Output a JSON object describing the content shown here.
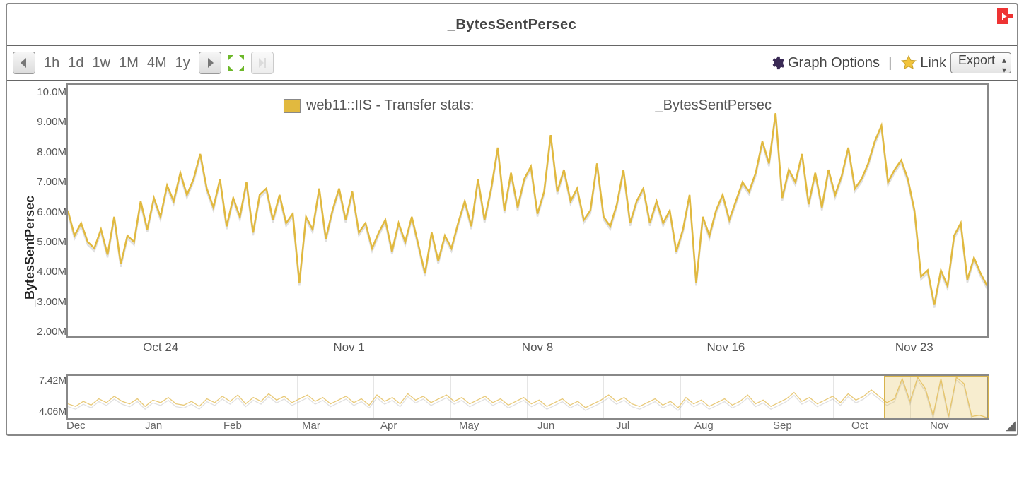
{
  "header": {
    "title": "_BytesSentPersec"
  },
  "toolbar": {
    "ranges": [
      "1h",
      "1d",
      "1w",
      "1M",
      "4M",
      "1y"
    ],
    "graph_options": "Graph Options",
    "link": "Link",
    "export": "Export",
    "separator": "|"
  },
  "legend": {
    "prefix": "web11::IIS - Transfer stats:",
    "suffix": "_BytesSentPersec",
    "color": "#e1b93f"
  },
  "y_axis": {
    "title": "_BytesSentPersec",
    "ticks": [
      "10.0M",
      "9.00M",
      "8.00M",
      "7.00M",
      "6.00M",
      "5.00M",
      "4.00M",
      "3.00M",
      "2.00M"
    ]
  },
  "x_axis": {
    "ticks": [
      "Oct 24",
      "Nov 1",
      "Nov 8",
      "Nov 16",
      "Nov 23"
    ]
  },
  "overview": {
    "y_ticks": [
      "7.42M",
      "4.06M"
    ],
    "x_ticks": [
      "Dec",
      "Jan",
      "Feb",
      "Mar",
      "Apr",
      "May",
      "Jun",
      "Jul",
      "Aug",
      "Sep",
      "Oct",
      "Nov"
    ],
    "selection": {
      "left_pct": 88.8,
      "width_pct": 11.2
    }
  },
  "chart_data": {
    "type": "line",
    "title": "_BytesSentPersec",
    "xlabel": "",
    "ylabel": "_BytesSentPersec",
    "ylim": [
      2000000,
      10000000
    ],
    "x_categories": [
      "Oct 24",
      "Nov 1",
      "Nov 8",
      "Nov 16",
      "Nov 23"
    ],
    "series": [
      {
        "name": "web11::IIS - Transfer stats: _BytesSentPersec",
        "color": "#e1b93f",
        "values": [
          6.0,
          5.2,
          5.6,
          5.0,
          4.8,
          5.4,
          4.6,
          5.8,
          4.3,
          5.2,
          5.0,
          6.3,
          5.4,
          6.4,
          5.8,
          6.8,
          6.3,
          7.2,
          6.5,
          7.0,
          7.8,
          6.7,
          6.1,
          7.0,
          5.5,
          6.4,
          5.8,
          6.9,
          5.3,
          6.5,
          6.7,
          5.7,
          6.5,
          5.6,
          5.9,
          3.7,
          5.8,
          5.4,
          6.7,
          5.1,
          6.0,
          6.7,
          5.7,
          6.6,
          5.3,
          5.6,
          4.8,
          5.3,
          5.7,
          4.7,
          5.6,
          5.0,
          5.8,
          4.9,
          4.0,
          5.3,
          4.4,
          5.2,
          4.8,
          5.6,
          6.3,
          5.5,
          7.0,
          5.7,
          6.7,
          8.0,
          6.0,
          7.2,
          6.1,
          7.0,
          7.4,
          5.9,
          6.6,
          8.4,
          6.6,
          7.3,
          6.3,
          6.7,
          5.7,
          6.0,
          7.5,
          5.8,
          5.5,
          6.2,
          7.3,
          5.6,
          6.3,
          6.7,
          5.6,
          6.3,
          5.6,
          6.0,
          4.7,
          5.4,
          6.5,
          3.7,
          5.8,
          5.2,
          6.0,
          6.5,
          5.7,
          6.3,
          6.9,
          6.6,
          7.2,
          8.2,
          7.5,
          9.1,
          6.4,
          7.3,
          6.9,
          7.8,
          6.2,
          7.2,
          6.1,
          7.3,
          6.5,
          7.1,
          8.0,
          6.7,
          7.0,
          7.5,
          8.2,
          8.7,
          6.9,
          7.3,
          7.6,
          7.0,
          6.0,
          3.9,
          4.1,
          3.0,
          4.1,
          3.6,
          5.2,
          5.6,
          3.8,
          4.5,
          4.0,
          3.6
        ],
        "unit": "M"
      }
    ],
    "overview_series": {
      "ylim": [
        4060000,
        7420000
      ],
      "unit": "M",
      "values": [
        5.2,
        5.0,
        5.4,
        5.1,
        5.6,
        5.3,
        5.8,
        5.4,
        5.2,
        5.6,
        5.0,
        5.5,
        5.3,
        5.7,
        5.2,
        5.1,
        5.4,
        5.0,
        5.6,
        5.3,
        5.8,
        5.4,
        5.9,
        5.2,
        5.7,
        5.4,
        6.0,
        5.5,
        5.8,
        5.3,
        5.6,
        5.9,
        5.4,
        5.7,
        5.2,
        5.5,
        5.8,
        5.3,
        5.6,
        5.1,
        5.9,
        5.4,
        5.7,
        5.2,
        6.0,
        5.5,
        5.8,
        5.3,
        5.6,
        5.9,
        5.4,
        5.7,
        5.2,
        5.5,
        5.8,
        5.3,
        5.6,
        5.1,
        5.4,
        5.7,
        5.2,
        5.5,
        5.0,
        5.3,
        5.6,
        5.1,
        5.4,
        4.9,
        5.2,
        5.5,
        5.9,
        5.4,
        5.7,
        5.2,
        5.0,
        5.3,
        5.6,
        5.1,
        5.4,
        4.9,
        5.7,
        5.2,
        5.5,
        5.0,
        5.3,
        5.6,
        5.1,
        5.4,
        5.9,
        5.2,
        5.5,
        5.0,
        5.3,
        5.6,
        6.1,
        5.4,
        5.7,
        5.2,
        5.5,
        5.8,
        5.3,
        6.0,
        5.5,
        5.8,
        6.3,
        5.8,
        5.3,
        5.6,
        7.2,
        5.4,
        7.3,
        6.4,
        4.3,
        7.2,
        4.2,
        7.3,
        6.8,
        4.2,
        4.3,
        4.1
      ]
    }
  }
}
